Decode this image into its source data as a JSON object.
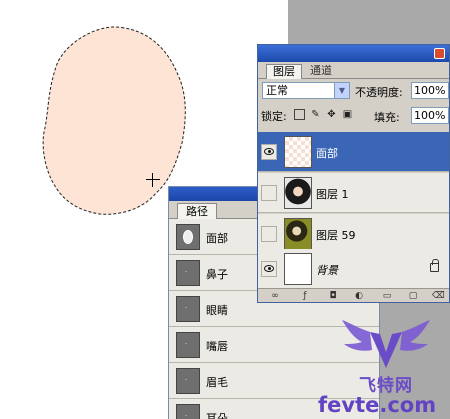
{
  "layers_panel": {
    "tabs": [
      "图层",
      "通道"
    ],
    "blend_mode": "正常",
    "opacity_label": "不透明度:",
    "opacity_value": "100%",
    "lock_label": "锁定:",
    "fill_label": "填充:",
    "fill_value": "100%",
    "layers": [
      {
        "name": "面部",
        "visible": true,
        "selected": true,
        "thumb": "transparent-checker"
      },
      {
        "name": "图层 1",
        "visible": false,
        "selected": false,
        "thumb": "portrait-photo"
      },
      {
        "name": "图层 59",
        "visible": false,
        "selected": false,
        "thumb": "portrait-photo"
      },
      {
        "name": "背景",
        "visible": true,
        "selected": false,
        "thumb": "white",
        "locked": true
      }
    ]
  },
  "paths_panel": {
    "tab": "路径",
    "paths": [
      "面部",
      "鼻子",
      "眼睛",
      "嘴唇",
      "眉毛",
      "耳朵"
    ]
  },
  "canvas": {
    "shape_fill": "#fde4d4",
    "background": "#ffffff"
  },
  "watermark": {
    "cn": "飞特网",
    "domain": "fevte.com"
  },
  "colors": {
    "selected_row": "#3a66b5",
    "panel_bg": "#d4d0c8",
    "row_bg": "#ebeae4",
    "watermark": "#6b4cc8"
  }
}
